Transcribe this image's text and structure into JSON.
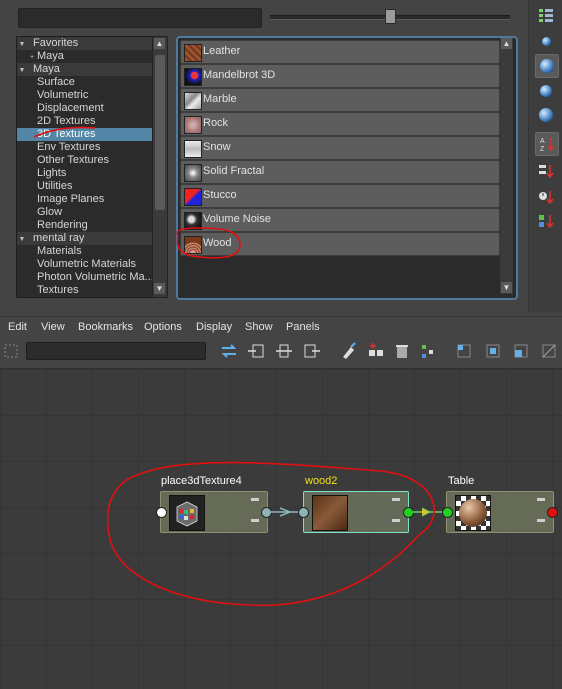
{
  "browser": {
    "tree": [
      {
        "label": "Favorites",
        "kind": "header",
        "expander": "▼"
      },
      {
        "label": "Maya",
        "kind": "item",
        "expander": "+"
      },
      {
        "label": "Maya",
        "kind": "header",
        "expander": "▼"
      },
      {
        "label": "Surface",
        "kind": "item"
      },
      {
        "label": "Volumetric",
        "kind": "item"
      },
      {
        "label": "Displacement",
        "kind": "item"
      },
      {
        "label": "2D Textures",
        "kind": "item"
      },
      {
        "label": "3D Textures",
        "kind": "item",
        "selected": true
      },
      {
        "label": "Env Textures",
        "kind": "item"
      },
      {
        "label": "Other Textures",
        "kind": "item"
      },
      {
        "label": "Lights",
        "kind": "item"
      },
      {
        "label": "Utilities",
        "kind": "item"
      },
      {
        "label": "Image Planes",
        "kind": "item"
      },
      {
        "label": "Glow",
        "kind": "item"
      },
      {
        "label": "Rendering",
        "kind": "item"
      },
      {
        "label": "mental ray",
        "kind": "header",
        "expander": "▼"
      },
      {
        "label": "Materials",
        "kind": "item"
      },
      {
        "label": "Volumetric Materials",
        "kind": "item"
      },
      {
        "label": "Photon Volumetric Ma...",
        "kind": "item"
      },
      {
        "label": "Textures",
        "kind": "item"
      }
    ],
    "nodes": [
      {
        "label": "Leather",
        "icon": "leather-texture-icon"
      },
      {
        "label": "Mandelbrot 3D",
        "icon": "mandelbrot-3d-icon"
      },
      {
        "label": "Marble",
        "icon": "marble-texture-icon"
      },
      {
        "label": "Rock",
        "icon": "rock-texture-icon"
      },
      {
        "label": "Snow",
        "icon": "snow-texture-icon"
      },
      {
        "label": "Solid Fractal",
        "icon": "solid-fractal-icon"
      },
      {
        "label": "Stucco",
        "icon": "stucco-texture-icon"
      },
      {
        "label": "Volume Noise",
        "icon": "volume-noise-icon"
      },
      {
        "label": "Wood",
        "icon": "wood-texture-icon"
      }
    ],
    "scroll_up": "▲",
    "scroll_down": "▼"
  },
  "menus": [
    "Edit",
    "View",
    "Bookmarks",
    "Options",
    "Display",
    "Show",
    "Panels"
  ],
  "graph": {
    "nodes": [
      {
        "name": "place3dTexture4",
        "title_color": "#ffffff",
        "selected": false
      },
      {
        "name": "wood2",
        "title_color": "#f0e020",
        "selected": true
      },
      {
        "name": "Table",
        "title_color": "#ffffff",
        "selected": false
      }
    ]
  },
  "colors": {
    "selection": "#5285a6",
    "annotation": "#e01010",
    "panel_border": "#4f7aa0",
    "node_fill": "#666b57",
    "node_selected_border": "#7fe0c8"
  }
}
